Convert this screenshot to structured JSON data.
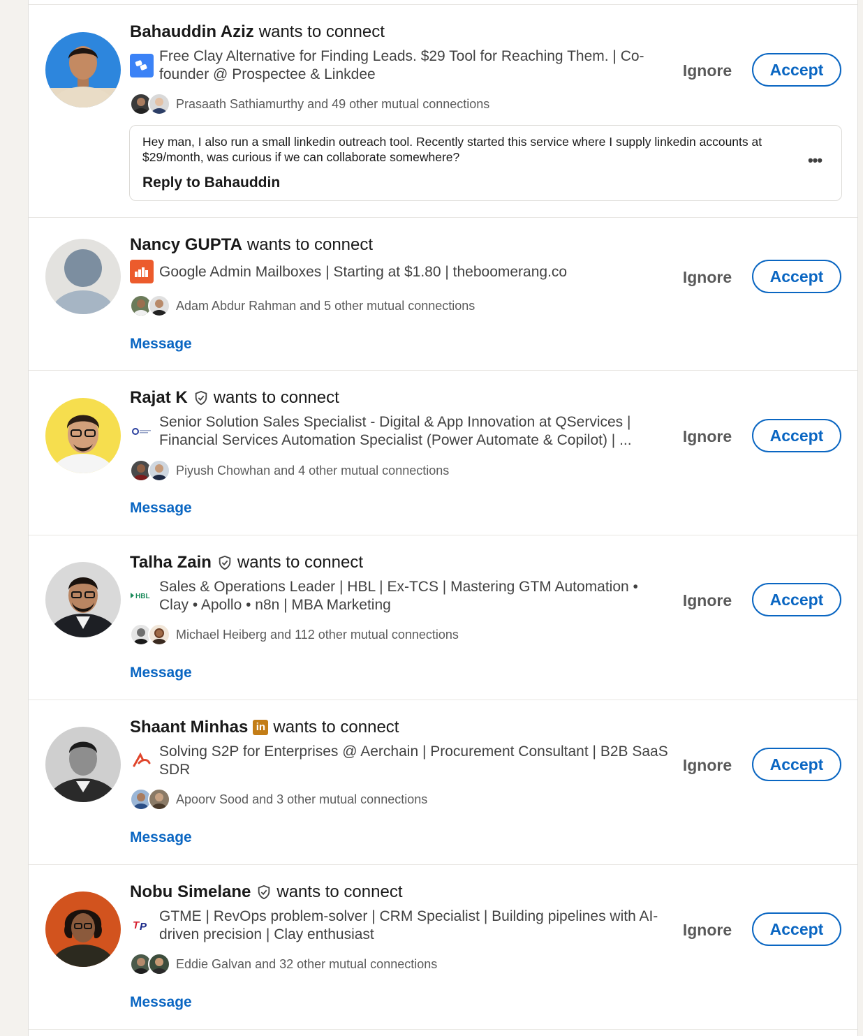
{
  "connection_word": "wants to connect",
  "ignore_label": "Ignore",
  "accept_label": "Accept",
  "message_label": "Message",
  "invitations": [
    {
      "name": "Bahauddin Aziz",
      "badge": "none",
      "headline": "Free Clay Alternative for Finding Leads. $29 Tool for Reaching Them. | Co-founder @ Prospectee & Linkdee",
      "mutual": "Prasaath Sathiamurthy and 49 other mutual connections",
      "note": "Hey man, I also run a small linkedin outreach tool. Recently started this service where I supply linkedin accounts at $29/month, was curious if we can collaborate somewhere?",
      "reply_label": "Reply to Bahauddin",
      "more_label": "•••"
    },
    {
      "name": "Nancy GUPTA",
      "badge": "none",
      "headline": "Google Admin Mailboxes | Starting at $1.80 | theboomerang.co",
      "mutual": "Adam Abdur Rahman and 5 other mutual connections"
    },
    {
      "name": "Rajat K",
      "badge": "verified",
      "headline": "Senior Solution Sales Specialist - Digital & App Innovation at QServices | Financial Services Automation Specialist (Power Automate & Copilot) | ...",
      "mutual": "Piyush Chowhan and 4 other mutual connections"
    },
    {
      "name": "Talha Zain",
      "badge": "verified",
      "headline": "Sales & Operations Leader | HBL | Ex-TCS | Mastering GTM Automation • Clay • Apollo • n8n | MBA Marketing",
      "mutual": "Michael Heiberg and 112 other mutual connections"
    },
    {
      "name": "Shaant Minhas",
      "badge": "premium",
      "premium_text": "in",
      "headline": "Solving S2P for Enterprises @ Aerchain | Procurement Consultant | B2B SaaS SDR",
      "mutual": "Apoorv Sood and 3 other mutual connections"
    },
    {
      "name": "Nobu Simelane",
      "badge": "verified",
      "headline": "GTME | RevOps problem-solver | CRM Specialist | Building pipelines with AI-driven precision | Clay enthusiast",
      "mutual": "Eddie Galvan and 32 other mutual connections"
    }
  ],
  "colors": {
    "accent": "#0a66c2",
    "page_bg": "#f4f2ee",
    "card_bg": "#ffffff",
    "premium_gold": "#c37d16"
  }
}
